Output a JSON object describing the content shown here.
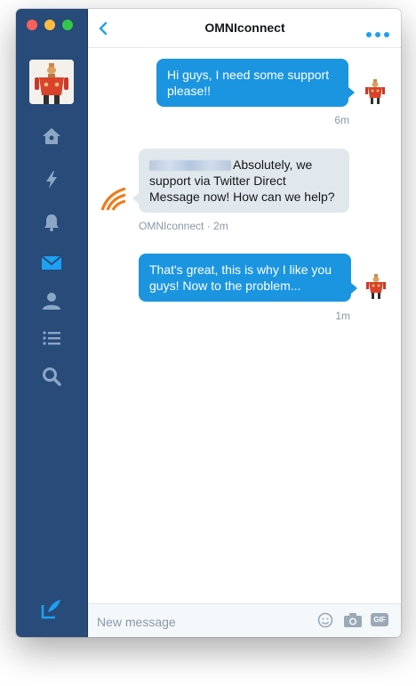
{
  "header": {
    "title": "OMNIconnect"
  },
  "sidebar": {
    "items": [
      {
        "name": "home-icon"
      },
      {
        "name": "lightning-icon"
      },
      {
        "name": "bell-icon"
      },
      {
        "name": "mail-icon"
      },
      {
        "name": "profile-icon"
      },
      {
        "name": "list-icon"
      },
      {
        "name": "search-icon"
      }
    ],
    "active_color": "#1da1f2",
    "icon_color": "#8ca6c6"
  },
  "messages": [
    {
      "text": "Hi guys, I need some support please!!",
      "meta": "6m",
      "direction": "outgoing"
    },
    {
      "text": "Absolutely, we support via Twitter Direct Message now! How can we help?",
      "meta": "OMNIconnect · 2m",
      "direction": "incoming"
    },
    {
      "text": "That's great, this is why I like you guys! Now to the problem...",
      "meta": "1m",
      "direction": "outgoing"
    }
  ],
  "composer": {
    "placeholder": "New message",
    "gif_label": "GIF"
  },
  "colors": {
    "sidebar": "#284b7a",
    "accent": "#1b95e0",
    "incoming_bubble": "#e1e8ed"
  }
}
